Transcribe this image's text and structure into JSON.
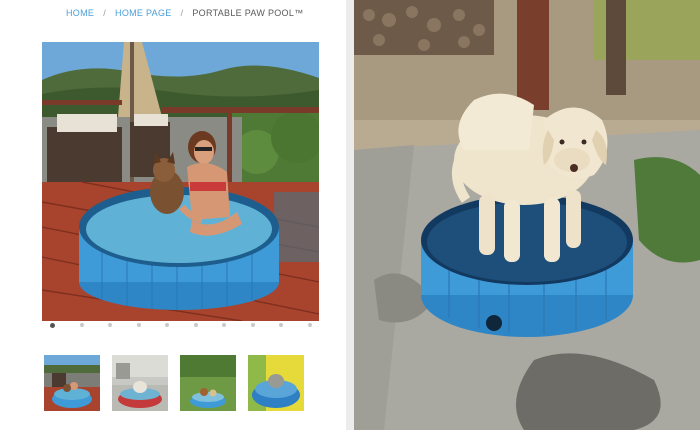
{
  "breadcrumb": {
    "home": "HOME",
    "home_page": "HOME PAGE",
    "separator": "/",
    "current": "PORTABLE PAW POOL™"
  },
  "colors": {
    "link": "#4a9fd8",
    "pool_blue": "#3f9ad8",
    "deck_red": "#a8442e"
  },
  "gallery": {
    "main_image": "woman-and-dog-in-blue-pool-on-deck",
    "thumbnails": [
      "woman-and-dog-in-blue-pool-on-deck",
      "dog-in-red-pool",
      "dogs-in-blue-pool-on-grass",
      "dog-in-blue-pool-yellow-background"
    ],
    "dots_count": 10,
    "active_dot": 0
  },
  "right_image": "golden-retriever-standing-in-blue-pool"
}
